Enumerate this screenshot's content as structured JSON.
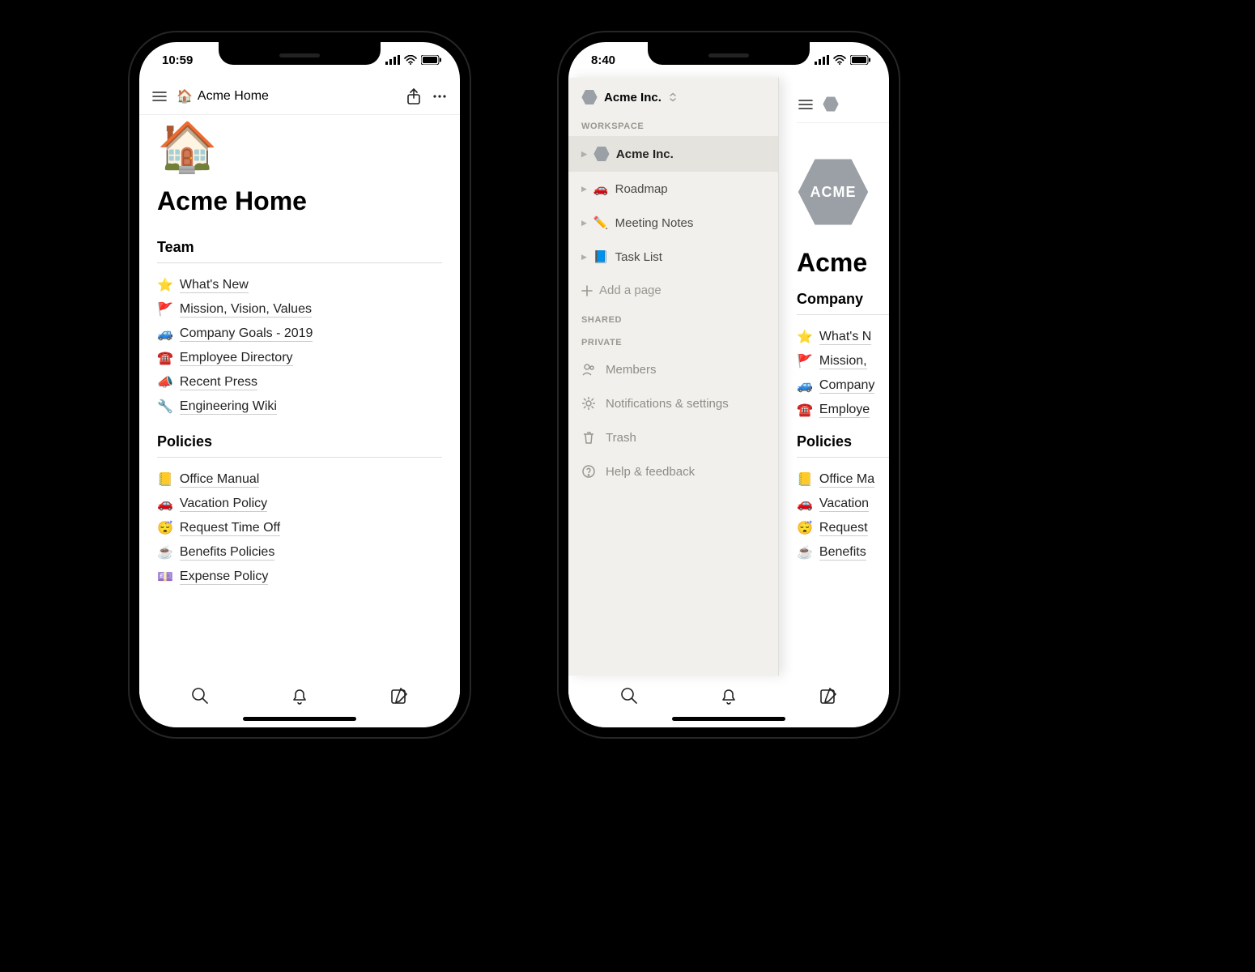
{
  "phone1": {
    "status_time": "10:59",
    "topbar": {
      "title_emoji": "🏠",
      "title": "Acme Home"
    },
    "page": {
      "emoji": "🏠",
      "title": "Acme Home"
    },
    "sections": {
      "team": {
        "heading": "Team",
        "items": [
          {
            "emoji": "⭐",
            "label": "What's New"
          },
          {
            "emoji": "🚩",
            "label": "Mission, Vision, Values"
          },
          {
            "emoji": "🚙",
            "label": "Company Goals - 2019"
          },
          {
            "emoji": "☎️",
            "label": "Employee Directory"
          },
          {
            "emoji": "📣",
            "label": "Recent Press"
          },
          {
            "emoji": "🔧",
            "label": "Engineering Wiki"
          }
        ]
      },
      "policies": {
        "heading": "Policies",
        "items": [
          {
            "emoji": "📒",
            "label": "Office Manual"
          },
          {
            "emoji": "🚗",
            "label": "Vacation Policy"
          },
          {
            "emoji": "😴",
            "label": "Request Time Off"
          },
          {
            "emoji": "☕",
            "label": "Benefits Policies"
          },
          {
            "emoji": "💷",
            "label": "Expense Policy"
          }
        ]
      }
    }
  },
  "phone2": {
    "status_time": "8:40",
    "workspace_name": "Acme Inc.",
    "workspace_logo_text": "ACME",
    "sidebar": {
      "section_workspace": "WORKSPACE",
      "items": [
        {
          "emoji": "",
          "label": "Acme Inc.",
          "active": true,
          "logo": true
        },
        {
          "emoji": "🚗",
          "label": "Roadmap"
        },
        {
          "emoji": "✏️",
          "label": "Meeting Notes"
        },
        {
          "emoji": "📘",
          "label": "Task List"
        }
      ],
      "add_label": "Add a page",
      "section_shared": "SHARED",
      "section_private": "PRIVATE",
      "footer": {
        "members": "Members",
        "settings": "Notifications & settings",
        "trash": "Trash",
        "help": "Help & feedback"
      }
    },
    "content": {
      "title_fragment": "Acme",
      "company_heading": "Company",
      "items": [
        {
          "emoji": "⭐",
          "label": "What's N"
        },
        {
          "emoji": "🚩",
          "label": "Mission,"
        },
        {
          "emoji": "🚙",
          "label": "Company"
        },
        {
          "emoji": "☎️",
          "label": "Employe"
        }
      ],
      "policies_heading": "Policies",
      "policies": [
        {
          "emoji": "📒",
          "label": "Office Ma"
        },
        {
          "emoji": "🚗",
          "label": "Vacation"
        },
        {
          "emoji": "😴",
          "label": "Request"
        },
        {
          "emoji": "☕",
          "label": "Benefits"
        }
      ]
    }
  }
}
